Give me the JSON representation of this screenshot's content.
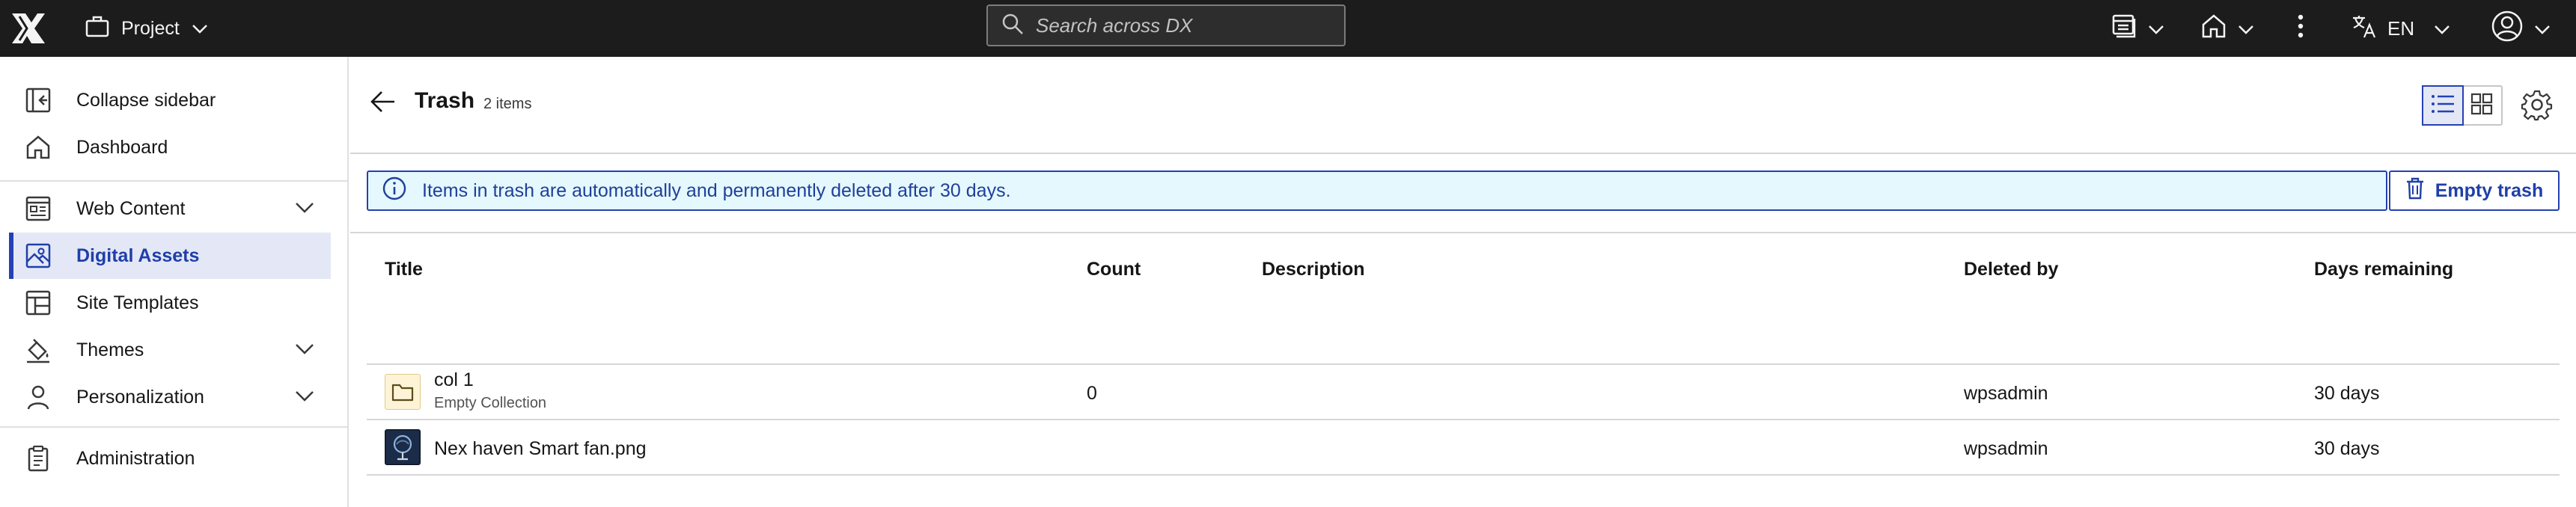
{
  "topbar": {
    "project_label": "Project",
    "search_placeholder": "Search across DX",
    "language": "EN"
  },
  "sidebar": {
    "items": [
      {
        "label": "Collapse sidebar"
      },
      {
        "label": "Dashboard"
      },
      {
        "label": "Web Content"
      },
      {
        "label": "Digital Assets"
      },
      {
        "label": "Site Templates"
      },
      {
        "label": "Themes"
      },
      {
        "label": "Personalization"
      },
      {
        "label": "Administration"
      }
    ]
  },
  "page": {
    "title": "Trash",
    "count": "2 items",
    "notice": "Items in trash are automatically and permanently deleted after 30 days.",
    "empty_trash_label": "Empty trash"
  },
  "table": {
    "columns": [
      "Title",
      "Count",
      "Description",
      "Deleted by",
      "Days remaining"
    ],
    "rows": [
      {
        "title": "col 1",
        "subtitle": "Empty Collection",
        "count": "0",
        "description": "",
        "deleted_by": "wpsadmin",
        "days_remaining": "30 days"
      },
      {
        "title": "Nex haven Smart fan.png",
        "subtitle": "",
        "count": "",
        "description": "",
        "deleted_by": "wpsadmin",
        "days_remaining": "30 days"
      }
    ]
  },
  "colors": {
    "accent": "#2541b2",
    "topbar_bg": "#1c1c1c",
    "notice_bg": "#e4f8fd",
    "active_bg": "#e4e8f6"
  }
}
